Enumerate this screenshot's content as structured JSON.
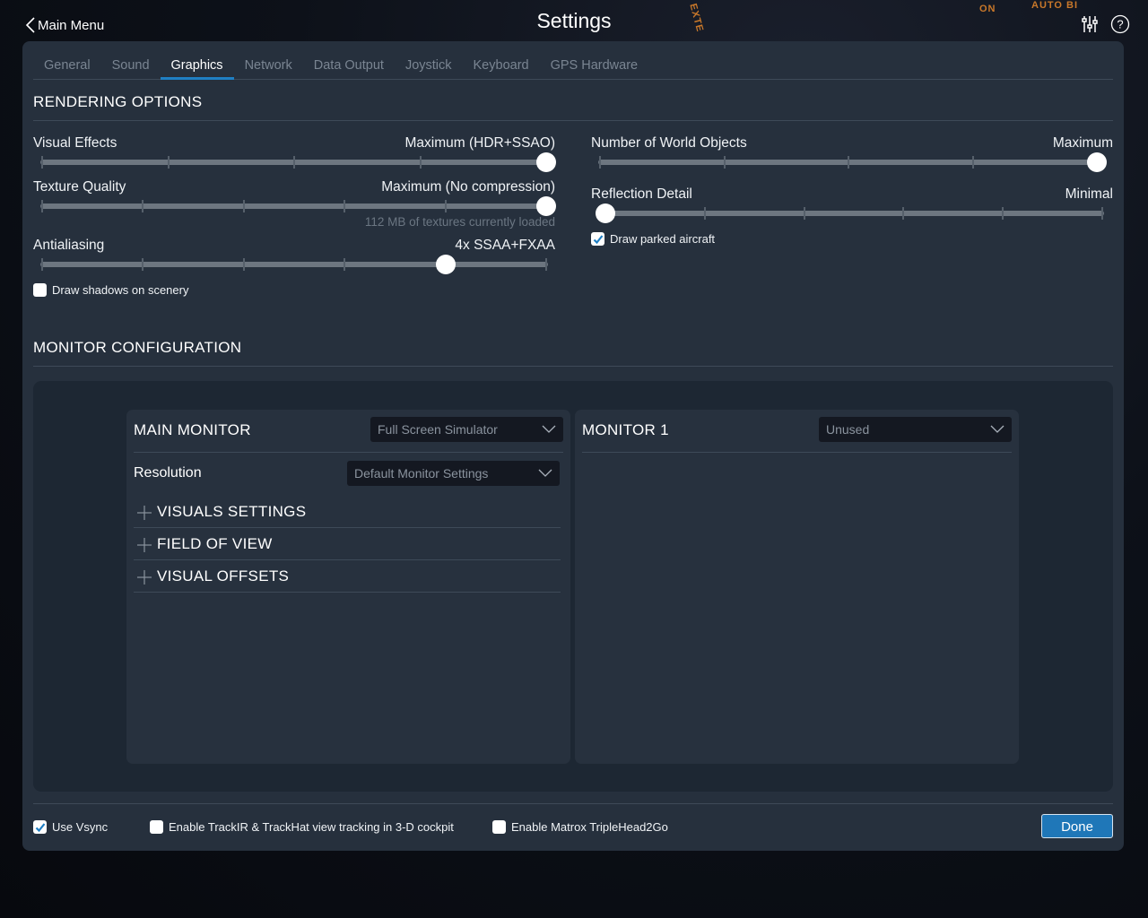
{
  "header": {
    "back_label": "Main Menu",
    "title": "Settings",
    "icons": [
      "sliders-icon",
      "help-icon"
    ]
  },
  "tabs": [
    {
      "label": "General",
      "active": false
    },
    {
      "label": "Sound",
      "active": false
    },
    {
      "label": "Graphics",
      "active": true
    },
    {
      "label": "Network",
      "active": false
    },
    {
      "label": "Data Output",
      "active": false
    },
    {
      "label": "Joystick",
      "active": false
    },
    {
      "label": "Keyboard",
      "active": false
    },
    {
      "label": "GPS Hardware",
      "active": false
    }
  ],
  "rendering": {
    "title": "RENDERING OPTIONS",
    "sliders": {
      "visual_effects": {
        "label": "Visual Effects",
        "value": "Maximum (HDR+SSAO)",
        "steps": 5,
        "position": 4
      },
      "texture_quality": {
        "label": "Texture Quality",
        "value": "Maximum (No compression)",
        "steps": 6,
        "position": 5,
        "note": "112 MB of textures currently loaded"
      },
      "antialiasing": {
        "label": "Antialiasing",
        "value": "4x SSAA+FXAA",
        "steps": 6,
        "position": 4
      },
      "world_objects": {
        "label": "Number of World Objects",
        "value": "Maximum",
        "steps": 5,
        "position": 4
      },
      "reflection_detail": {
        "label": "Reflection Detail",
        "value": "Minimal",
        "steps": 6,
        "position": 0
      }
    },
    "checkboxes": {
      "draw_shadows": {
        "label": "Draw shadows on scenery",
        "checked": false
      },
      "draw_parked": {
        "label": "Draw parked aircraft",
        "checked": true
      }
    }
  },
  "monitor": {
    "title": "MONITOR CONFIGURATION",
    "main": {
      "title": "MAIN MONITOR",
      "mode": "Full Screen Simulator",
      "resolution_label": "Resolution",
      "resolution": "Default Monitor Settings",
      "sections": [
        "VISUALS SETTINGS",
        "FIELD OF VIEW",
        "VISUAL OFFSETS"
      ]
    },
    "monitor1": {
      "title": "MONITOR 1",
      "mode": "Unused"
    }
  },
  "footer": {
    "vsync": {
      "label": "Use Vsync",
      "checked": true
    },
    "trackir": {
      "label": "Enable TrackIR & TrackHat view tracking in 3-D cockpit",
      "checked": false
    },
    "matrox": {
      "label": "Enable Matrox TripleHead2Go",
      "checked": false
    },
    "done_label": "Done"
  },
  "colors": {
    "accent": "#1f7fc4",
    "panel": "#26303d",
    "inner_panel": "#1d2733",
    "card": "#27313e"
  }
}
